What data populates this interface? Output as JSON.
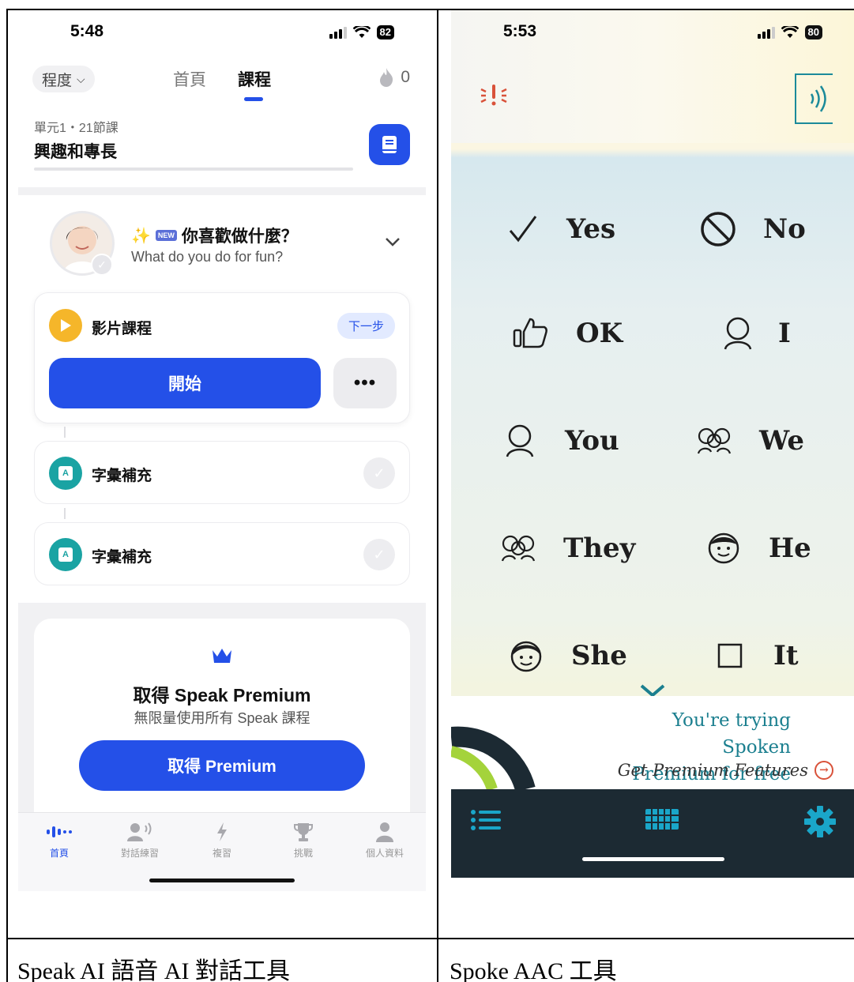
{
  "left_phone": {
    "status": {
      "time": "5:48",
      "battery": "82"
    },
    "nav": {
      "level_label": "程度",
      "tabs": [
        {
          "label": "首頁",
          "active": false
        },
        {
          "label": "課程",
          "active": true
        }
      ],
      "streak_count": "0"
    },
    "unit": {
      "subtitle": "單元1・21節課",
      "title": "興趣和專長"
    },
    "lesson": {
      "new_badge": "NEW",
      "title": "你喜歡做什麼？",
      "subtitle_en": "What do you do for fun?"
    },
    "video_card": {
      "label": "影片課程",
      "next_label": "下一步",
      "start_label": "開始",
      "more_label": "•••"
    },
    "vocab_items": [
      {
        "label": "字彙補充"
      },
      {
        "label": "字彙補充"
      }
    ],
    "premium": {
      "title": "取得 Speak Premium",
      "subtitle": "無限量使用所有 Speak 課程",
      "button_label": "取得 Premium"
    },
    "tabbar": [
      {
        "label": "首頁",
        "icon": "waveform-icon",
        "active": true
      },
      {
        "label": "對話練習",
        "icon": "speaking-person-icon",
        "active": false
      },
      {
        "label": "複習",
        "icon": "lightning-icon",
        "active": false
      },
      {
        "label": "挑戰",
        "icon": "trophy-icon",
        "active": false
      },
      {
        "label": "個人資料",
        "icon": "person-icon",
        "active": false
      }
    ],
    "accent_color": "#2450e8"
  },
  "right_phone": {
    "status": {
      "time": "5:53",
      "battery": "80"
    },
    "phrases": [
      {
        "label": "Yes",
        "icon": "checkmark-icon"
      },
      {
        "label": "No",
        "icon": "prohibited-icon"
      },
      {
        "label": "OK",
        "icon": "thumbs-up-icon"
      },
      {
        "label": "I",
        "icon": "person-outline-icon"
      },
      {
        "label": "You",
        "icon": "person-outline-icon"
      },
      {
        "label": "We",
        "icon": "group-icon"
      },
      {
        "label": "They",
        "icon": "group-icon"
      },
      {
        "label": "He",
        "icon": "boy-face-icon"
      },
      {
        "label": "She",
        "icon": "girl-face-icon"
      },
      {
        "label": "It",
        "icon": "square-icon"
      }
    ],
    "promo": {
      "line1": "You're trying Spoken",
      "line2": "Premium for free",
      "link": "Get Premium Features"
    },
    "accent_color": "#1b7f8f"
  },
  "captions": {
    "left": "Speak AI  語音 AI 對話工具",
    "right": "Spoke AAC 工具"
  }
}
